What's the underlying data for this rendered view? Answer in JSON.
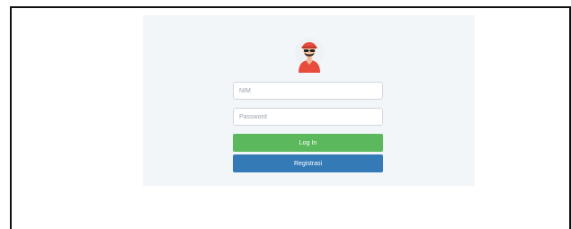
{
  "login_form": {
    "avatar_icon": "user-avatar-icon",
    "nim": {
      "placeholder": "NIM",
      "value": ""
    },
    "password": {
      "placeholder": "Password",
      "value": ""
    },
    "login_label": "Log In",
    "register_label": "Registrasi"
  },
  "colors": {
    "panel_bg": "#f3f6f9",
    "login_button": "#5cb85c",
    "register_button": "#337ab7",
    "avatar_cap": "#e74c3c"
  }
}
